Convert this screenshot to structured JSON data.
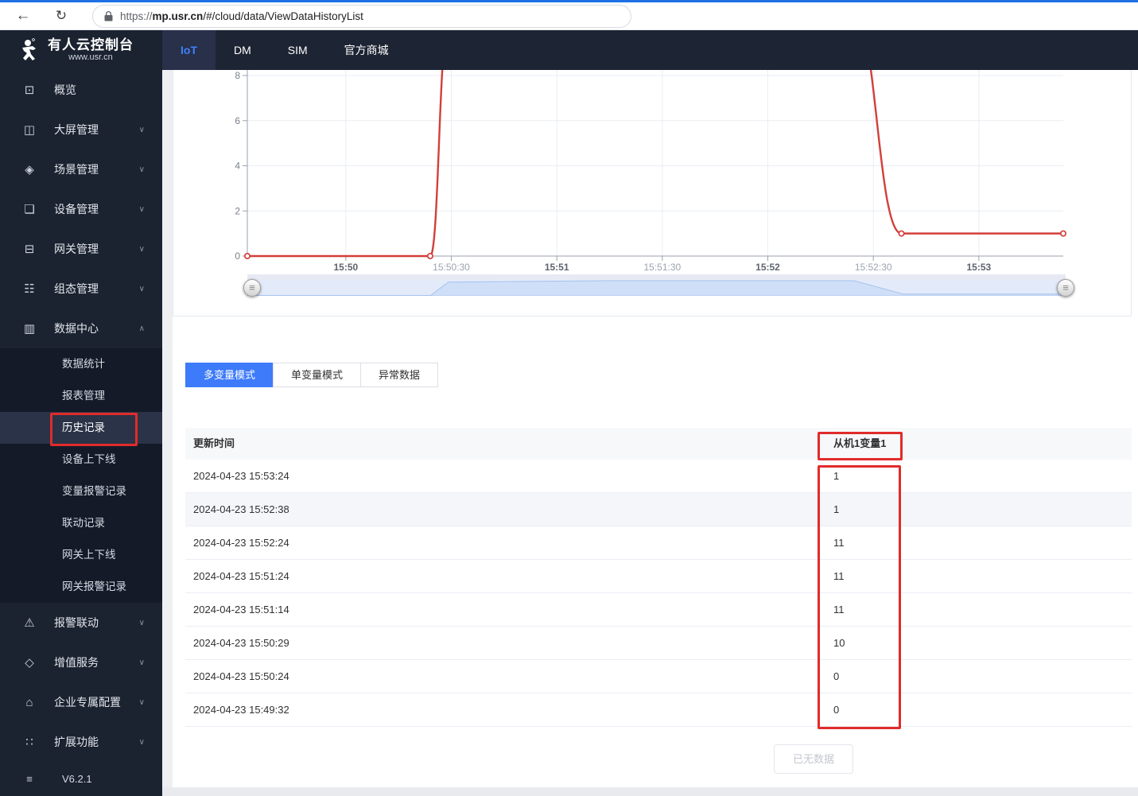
{
  "browser": {
    "back_icon": "←",
    "reload_icon": "↻",
    "url": {
      "protocol": "https://",
      "domain": "mp.usr.cn",
      "path": "/#/cloud/data/ViewDataHistoryList"
    }
  },
  "topnav": {
    "logo": {
      "title": "有人云控制台",
      "subtitle": "www.usr.cn"
    },
    "items": [
      {
        "name": "iot",
        "label": "IoT",
        "active": true
      },
      {
        "name": "dm",
        "label": "DM",
        "active": false
      },
      {
        "name": "sim",
        "label": "SIM",
        "active": false
      },
      {
        "name": "official-mall",
        "label": "官方商城",
        "active": false
      }
    ]
  },
  "sidebar": {
    "items_top": [
      {
        "name": "overview",
        "label": "概览",
        "icon": "overview-icon",
        "glyph": "⊡",
        "chevron": null
      },
      {
        "name": "screen-manage",
        "label": "大屏管理",
        "icon": "big-screen-icon",
        "glyph": "◫",
        "chevron": "down"
      },
      {
        "name": "scene-manage",
        "label": "场景管理",
        "icon": "scene-icon",
        "glyph": "◈",
        "chevron": "down"
      },
      {
        "name": "device-manage",
        "label": "设备管理",
        "icon": "device-icon",
        "glyph": "❏",
        "chevron": "down"
      },
      {
        "name": "gateway-manage",
        "label": "网关管理",
        "icon": "gateway-icon",
        "glyph": "⊟",
        "chevron": "down"
      },
      {
        "name": "scada-manage",
        "label": "组态管理",
        "icon": "scada-icon",
        "glyph": "☷",
        "chevron": "down"
      },
      {
        "name": "data-center",
        "label": "数据中心",
        "icon": "data-center-icon",
        "glyph": "▥",
        "chevron": "up"
      }
    ],
    "submenu": [
      {
        "name": "data-statistics",
        "label": "数据统计",
        "selected": false
      },
      {
        "name": "report-manage",
        "label": "报表管理",
        "selected": false
      },
      {
        "name": "history-records",
        "label": "历史记录",
        "selected": true
      },
      {
        "name": "device-online-offline",
        "label": "设备上下线",
        "selected": false
      },
      {
        "name": "variable-alarm-records",
        "label": "变量报警记录",
        "selected": false
      },
      {
        "name": "linkage-records",
        "label": "联动记录",
        "selected": false
      },
      {
        "name": "gateway-online-offline",
        "label": "网关上下线",
        "selected": false
      },
      {
        "name": "gateway-alarm-records",
        "label": "网关报警记录",
        "selected": false
      }
    ],
    "items_bottom": [
      {
        "name": "alarm-linkage",
        "label": "报警联动",
        "icon": "alarm-icon",
        "glyph": "⚠",
        "chevron": "down"
      },
      {
        "name": "value-added-services",
        "label": "增值服务",
        "icon": "value-added-icon",
        "glyph": "◇",
        "chevron": "down"
      },
      {
        "name": "enterprise-config",
        "label": "企业专属配置",
        "icon": "enterprise-icon",
        "glyph": "⌂",
        "chevron": "down"
      },
      {
        "name": "extensions",
        "label": "扩展功能",
        "icon": "extension-icon",
        "glyph": "∷",
        "chevron": "down"
      }
    ],
    "version": "V6.2.1",
    "version_icon_glyph": "≡"
  },
  "tabs": [
    {
      "name": "multi-variable-mode",
      "label": "多变量模式",
      "active": true
    },
    {
      "name": "single-variable-mode",
      "label": "单变量模式",
      "active": false
    },
    {
      "name": "abnormal-data",
      "label": "异常数据",
      "active": false
    }
  ],
  "table": {
    "headers": [
      "更新时间",
      "从机1变量1"
    ],
    "rows": [
      [
        "2024-04-23 15:53:24",
        "1"
      ],
      [
        "2024-04-23 15:52:38",
        "1"
      ],
      [
        "2024-04-23 15:52:24",
        "11"
      ],
      [
        "2024-04-23 15:51:24",
        "11"
      ],
      [
        "2024-04-23 15:51:14",
        "11"
      ],
      [
        "2024-04-23 15:50:29",
        "10"
      ],
      [
        "2024-04-23 15:50:24",
        "0"
      ],
      [
        "2024-04-23 15:49:32",
        "0"
      ]
    ],
    "hover_row_index": 1
  },
  "no_data_button": "已无数据",
  "chart_data": {
    "type": "line",
    "smooth": true,
    "grid": true,
    "datazoom_slider": true,
    "x_start": "15:49:32",
    "x_end": "15:53:24",
    "visible_ylim": [
      0,
      8.6
    ],
    "y_ticks": [
      0,
      2,
      4,
      6,
      8
    ],
    "x_ticks": [
      {
        "label": "15:50",
        "major": true
      },
      {
        "label": "15:50:30",
        "major": false
      },
      {
        "label": "15:51",
        "major": true
      },
      {
        "label": "15:51:30",
        "major": false
      },
      {
        "label": "15:52",
        "major": true
      },
      {
        "label": "15:52:30",
        "major": false
      },
      {
        "label": "15:53",
        "major": true
      }
    ],
    "series": [
      {
        "name": "从机1变量1",
        "color": "#d23f3a",
        "points": [
          {
            "t": "15:49:32",
            "v": 0
          },
          {
            "t": "15:50:24",
            "v": 0
          },
          {
            "t": "15:50:29",
            "v": 10
          },
          {
            "t": "15:51:14",
            "v": 11
          },
          {
            "t": "15:51:24",
            "v": 11
          },
          {
            "t": "15:52:24",
            "v": 11
          },
          {
            "t": "15:52:38",
            "v": 1
          },
          {
            "t": "15:53:24",
            "v": 1
          }
        ]
      }
    ]
  },
  "colors": {
    "annotation_red": "#e12b2b",
    "series_red": "#d23f3a",
    "primary_blue": "#3e7bfa",
    "navbar_dark": "#1d2433",
    "sidebar_dark": "#1b2330",
    "submenu_dark": "#141a28",
    "selected_item": "#2a3347",
    "gridline": "#e9edf4",
    "axis": "#9aa2ac",
    "slider_fill": "#cfdff8",
    "table_header_bg": "#f7f8fa"
  }
}
